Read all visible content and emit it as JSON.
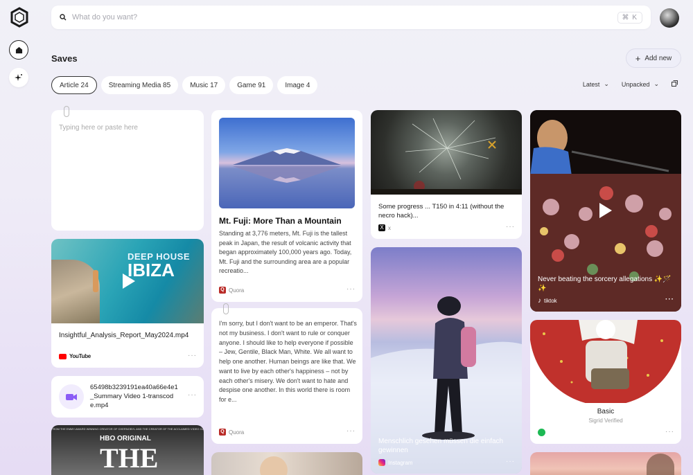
{
  "search": {
    "placeholder": "What do you want?",
    "shortcut": "⌘ K"
  },
  "header": {
    "title": "Saves",
    "add_label": "Add new"
  },
  "tabs": [
    {
      "label": "Article 24"
    },
    {
      "label": "Streaming Media 85"
    },
    {
      "label": "Music 17"
    },
    {
      "label": "Game 91"
    },
    {
      "label": "Image 4"
    }
  ],
  "sort": {
    "order": "Latest",
    "filter": "Unpacked"
  },
  "cards": {
    "note": {
      "placeholder": "Typing here or paste here"
    },
    "youtube": {
      "overlay_title": "DEEP HOUSE",
      "overlay_big": "IBIZA",
      "filename": "Insightful_Analysis_Report_May2024.mp4",
      "source": "YouTube"
    },
    "video_file": {
      "filename": "65498b3239191ea40a66e4e1_Summary Video 1-transcode.mp4"
    },
    "hbo": {
      "banner": "FROM THE EMMY-AWARD WINNING CREATOR OF CHERNOBYL AND THE CREATOR OF THE ACCLAIMED VIDEO GAME",
      "brand": "HBO ORIGINAL",
      "big": "THE"
    },
    "fuji": {
      "title": "Mt. Fuji: More Than a Mountain",
      "body": "Standing at 3,776 meters, Mt. Fuji is the tallest peak in Japan, the result of volcanic activity that began approximately 100,000 years ago. Today, Mt. Fuji and the surrounding area are a popular recreatio...",
      "source": "Quora"
    },
    "quote": {
      "body": "I'm sorry, but I don't want to be an emperor. That's not my business. I don't want to rule or conquer anyone. I should like to help everyone if possible – Jew, Gentile, Black Man, White. We all want to help one another. Human beings are like that. We want to live by each other's happiness – not by each other's misery. We don't want to hate and despise one another. In this world there is room for e...",
      "source": "Quora"
    },
    "game": {
      "caption": "Some progress ... T150 in 4:11 (without the necro hack)...",
      "source": "x"
    },
    "snow": {
      "caption": "Menschlich gesehen müssen die einfach gewinnen",
      "source": "Instagram"
    },
    "tiktok": {
      "caption": "Never beating the sorcery allegations ✨🪄✨",
      "source": "tiktok"
    },
    "spotify": {
      "title": "Basic",
      "subtitle": "Sigrid Verified"
    }
  },
  "colors": {
    "accent": "#6d5cf0",
    "quora": "#b92b27",
    "youtube": "#ff0000",
    "spotify": "#1db954"
  }
}
